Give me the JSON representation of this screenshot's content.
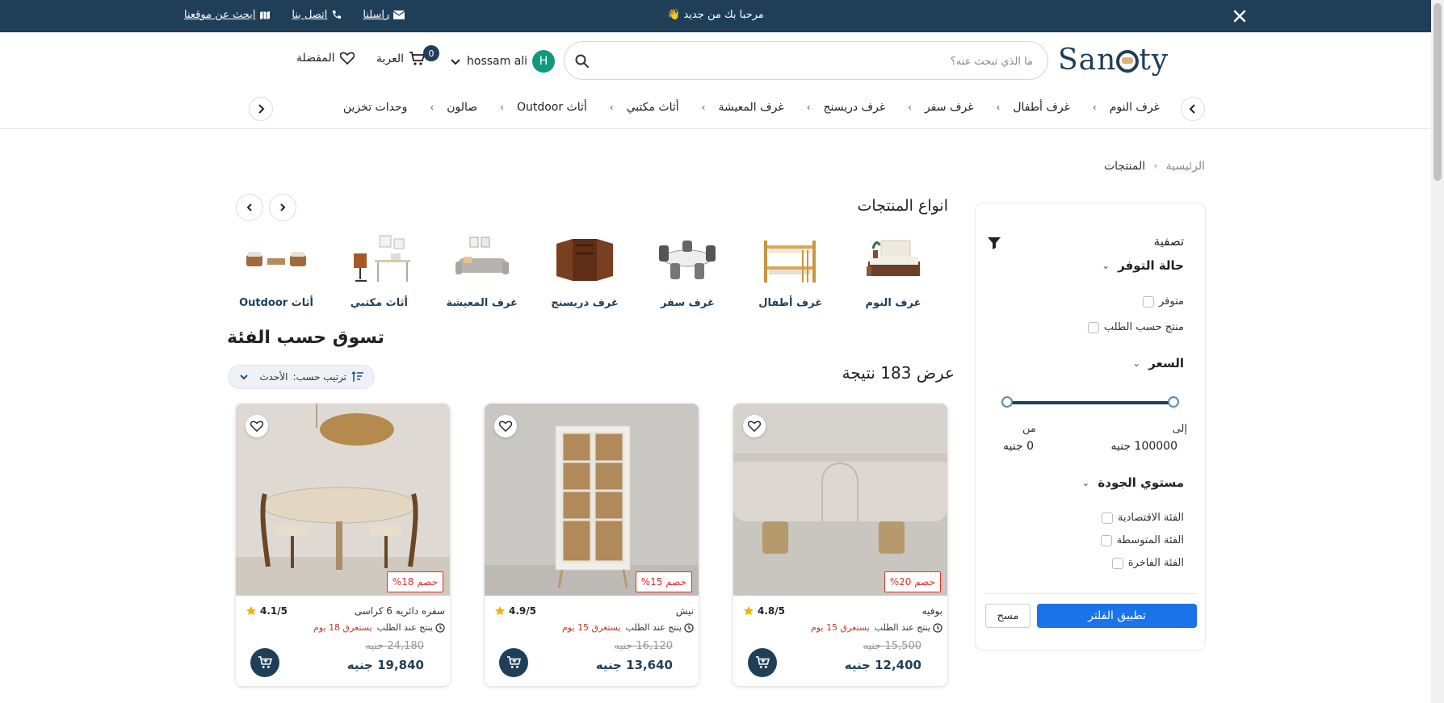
{
  "topbar": {
    "welcome": "مرحبا بك من جديد 👋",
    "links": [
      {
        "label": "راسلنا",
        "icon": "envelope-icon"
      },
      {
        "label": "اتصل بنا",
        "icon": "phone-icon"
      },
      {
        "label": "ابحث عن موقعنا",
        "icon": "map-icon"
      }
    ]
  },
  "header": {
    "logo": "SanOty",
    "search_placeholder": "ما الذي تبحث عنه؟",
    "user_name": "hossam ali",
    "avatar_letter": "H",
    "cart_label": "العربة",
    "cart_count": "0",
    "favorites_label": "المفضلة"
  },
  "nav": {
    "items": [
      "غرف النوم",
      "غرف أطفال",
      "غرف سفر",
      "غرف دريسنج",
      "غرف المعيشة",
      "أثاث مكتبي",
      "أثاث Outdoor",
      "صالون",
      "وحدات تخزين"
    ]
  },
  "breadcrumb": {
    "home": "الرئيسية",
    "current": "المنتجات"
  },
  "filter": {
    "title": "تصفية",
    "availability_title": "حالة التوفر",
    "availability_options": [
      "متوفر",
      "منتج حسب الطلب"
    ],
    "price_title": "السعر",
    "price_from_label": "من",
    "price_to_label": "إلى",
    "price_from_value": "0 جنيه",
    "price_to_value": "100000 جنيه",
    "quality_title": "مستوي الجودة",
    "quality_options": [
      "الفئة الاقتصادية",
      "الفئة المتوسطة",
      "الفئة الفاخرة"
    ],
    "apply_label": "تطبيق الفلتر",
    "clear_label": "مسح"
  },
  "product_types": {
    "title": "انواع المنتجات",
    "items": [
      "غرف النوم",
      "غرف أطفال",
      "غرف سفر",
      "غرف دريسنج",
      "غرف المعيشة",
      "أثاث مكتبي",
      "أثاث Outdoor"
    ]
  },
  "shop": {
    "title": "تسوق حسب الفئة",
    "results": "عرض 183 نتيجة",
    "sort_label": "ترتيب حسب:",
    "sort_value": "الأحدث"
  },
  "products": [
    {
      "name": "بوفيه",
      "rating": "4.8/5",
      "made_to_order": "ينتج عند الطلب",
      "days": "يستغرق 15 يوم",
      "old_price": "15,500 جنيه",
      "price": "12,400 جنيه",
      "discount": "خصم 20%"
    },
    {
      "name": "نيش",
      "rating": "4.9/5",
      "made_to_order": "ينتج عند الطلب",
      "days": "يستغرق 15 يوم",
      "old_price": "16,120 جنيه",
      "price": "13,640 جنيه",
      "discount": "خصم 15%"
    },
    {
      "name": "سفره دائريه 6 كراسى",
      "rating": "4.1/5",
      "made_to_order": "ينتج عند الطلب",
      "days": "يستغرق 18 يوم",
      "old_price": "24,180 جنيه",
      "price": "19,840 جنيه",
      "discount": "خصم 18%"
    }
  ],
  "colors": {
    "primary": "#1f3f58",
    "accent": "#1a73e8",
    "discount": "#d33333"
  }
}
